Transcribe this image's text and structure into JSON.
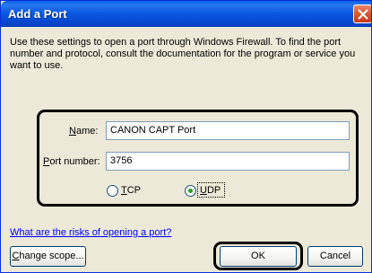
{
  "window": {
    "title": "Add a Port"
  },
  "description": "Use these settings to open a port through Windows Firewall. To find the port number and protocol, consult the documentation for the program or service you want to use.",
  "form": {
    "name_label_accel": "N",
    "name_label_rest": "ame:",
    "name_value": "CANON CAPT Port",
    "port_label_accel": "P",
    "port_label_rest": "ort number:",
    "port_value": "3756",
    "protocols": [
      {
        "accel": "T",
        "rest": "CP",
        "selected": false
      },
      {
        "accel": "U",
        "rest": "DP",
        "selected": true
      }
    ]
  },
  "link": {
    "text": "What are the risks of opening a port?"
  },
  "buttons": {
    "change_scope_accel": "C",
    "change_scope_rest": "hange scope...",
    "ok": "OK",
    "cancel": "Cancel"
  },
  "colors": {
    "titlebar": "#0a5fe8",
    "dialog_bg": "#ece9d8",
    "link": "#0000ff",
    "radio_selected": "#21a121"
  }
}
